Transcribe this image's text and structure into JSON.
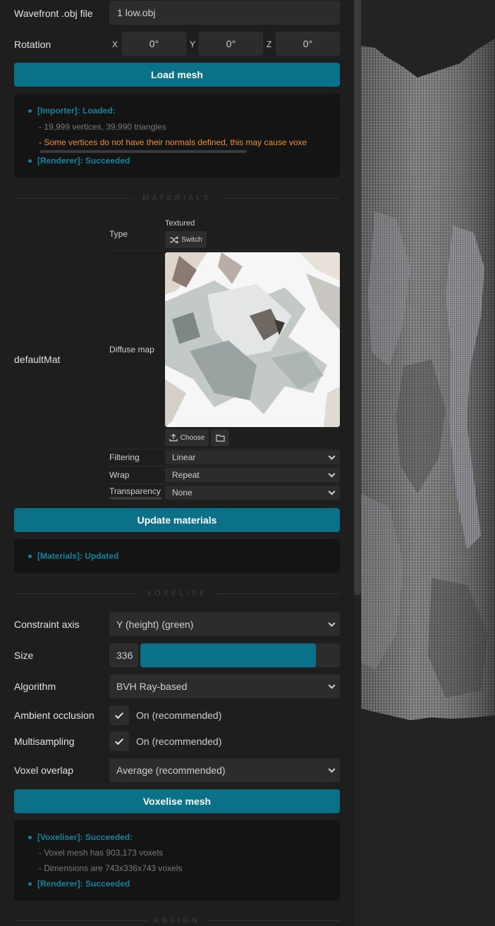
{
  "import": {
    "file_label": "Wavefront .obj file",
    "file_value": "1 low.obj",
    "rotation_label": "Rotation",
    "axes": [
      {
        "axis": "X",
        "value": "0°"
      },
      {
        "axis": "Y",
        "value": "0°"
      },
      {
        "axis": "Z",
        "value": "0°"
      }
    ],
    "load_button": "Load mesh",
    "log": {
      "head1": "[Importer]: Loaded:",
      "line1": "- 19,999 vertices, 39,990 triangles",
      "warn": "- Some vertices do not have their normals defined, this may cause voxe",
      "head2": "[Renderer]: Succeeded"
    }
  },
  "materials": {
    "section_title": "MATERIALS",
    "material_name": "defaultMat",
    "type_label": "Type",
    "type_value": "Textured",
    "switch_button": "Switch",
    "diffuse_label": "Diffuse map",
    "choose_button": "Choose",
    "filtering_label": "Filtering",
    "filtering_value": "Linear",
    "wrap_label": "Wrap",
    "wrap_value": "Repeat",
    "transparency_label": "Transparency",
    "transparency_value": "None",
    "update_button": "Update materials",
    "log_head": "[Materials]: Updated"
  },
  "voxelise": {
    "section_title": "VOXELISE",
    "constraint_label": "Constraint axis",
    "constraint_value": "Y (height) (green)",
    "size_label": "Size",
    "size_value": "336",
    "size_fill_fraction": 0.88,
    "algorithm_label": "Algorithm",
    "algorithm_value": "BVH Ray-based",
    "ao_label": "Ambient occlusion",
    "ao_value": "On (recommended)",
    "ms_label": "Multisampling",
    "ms_value": "On (recommended)",
    "overlap_label": "Voxel overlap",
    "overlap_value": "Average (recommended)",
    "voxelise_button": "Voxelise mesh",
    "log": {
      "head1": "[Voxeliser]: Succeeded:",
      "line1": "- Voxel mesh has 903,173 voxels",
      "line2": "- Dimensions are 743x336x743 voxels",
      "head2": "[Renderer]: Succeeded"
    }
  },
  "assign": {
    "section_title": "ASSIGN"
  },
  "icons": [
    "shuffle-icon",
    "upload-icon",
    "folder-icon",
    "chevron-down-icon",
    "check-icon"
  ],
  "colors": {
    "accent": "#0b7189",
    "log_accent": "#15829b",
    "warning": "#f08e2b",
    "background": "#1e1e1e"
  }
}
